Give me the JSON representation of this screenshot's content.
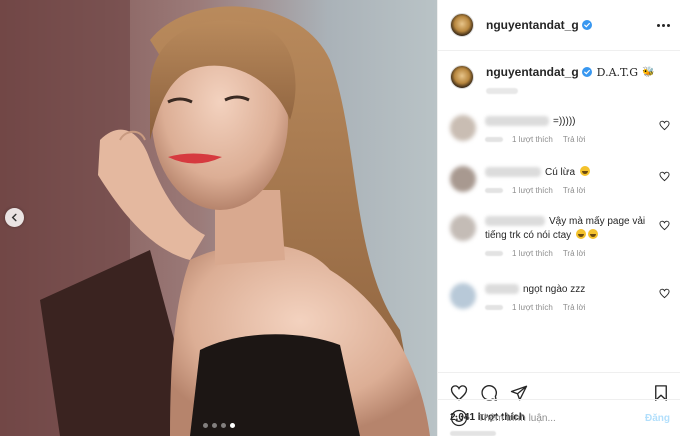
{
  "post": {
    "username": "nguyentandat_g",
    "caption": "D.A.T.G",
    "likes": "2,041 lượt thích",
    "photo_alt": "Photo",
    "carousel_dots": 4,
    "carousel_active": 4
  },
  "comments": [
    {
      "text": "=)))))",
      "emoji": 0,
      "likes": "1 lượt thích",
      "reply": "Trả lời",
      "avatar_color": "#c9bdb3"
    },
    {
      "text": "Cú lừa",
      "emoji": 1,
      "likes": "1 lượt thích",
      "reply": "Trả lời",
      "avatar_color": "#a89990"
    },
    {
      "text": "Vậy mà mấy page vải tiếng trk có nói ctay",
      "emoji": 2,
      "likes": "1 lượt thích",
      "reply": "Trả lời",
      "avatar_color": "#c4bcb6"
    },
    {
      "text": "ngọt ngào zzz",
      "emoji": 0,
      "likes": "1 lượt thích",
      "reply": "Trả lời",
      "avatar_color": "#b8c9d8"
    }
  ],
  "composer": {
    "placeholder": "Thêm bình luận...",
    "post_label": "Đăng"
  },
  "icons": [
    "verified-icon",
    "more-icon",
    "heart-icon",
    "comment-icon",
    "share-icon",
    "bookmark-icon",
    "emoji-icon",
    "chevron-left-icon"
  ],
  "colors": {
    "verified": "#3897f0",
    "post_button": "#b2dffc",
    "muted": "#8e8e8e"
  }
}
